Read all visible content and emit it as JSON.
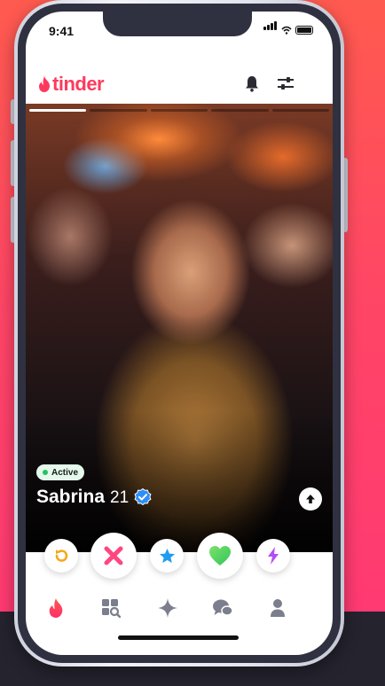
{
  "status": {
    "time": "9:41"
  },
  "header": {
    "logo_text": "tinder",
    "brand_color": "#fd3a5d"
  },
  "photo_progress": {
    "segments": 5,
    "active_index": 0
  },
  "profile": {
    "active_label": "Active",
    "name": "Sabrina",
    "age": "21",
    "verified": true
  },
  "actions": [
    {
      "icon": "rewind-icon",
      "color": "#f6a81b"
    },
    {
      "icon": "nope-x-icon",
      "color": "#ff4680"
    },
    {
      "icon": "super-like-star-icon",
      "color": "#1e9cf0"
    },
    {
      "icon": "like-heart-icon",
      "color": "#4ed65c"
    },
    {
      "icon": "boost-lightning-icon",
      "color": "#b54cf5"
    }
  ],
  "tabs": [
    {
      "icon": "flame-icon",
      "selected": true
    },
    {
      "icon": "explore-icon",
      "selected": false
    },
    {
      "icon": "sparkle-icon",
      "selected": false
    },
    {
      "icon": "chat-icon",
      "selected": false
    },
    {
      "icon": "profile-icon",
      "selected": false
    }
  ]
}
